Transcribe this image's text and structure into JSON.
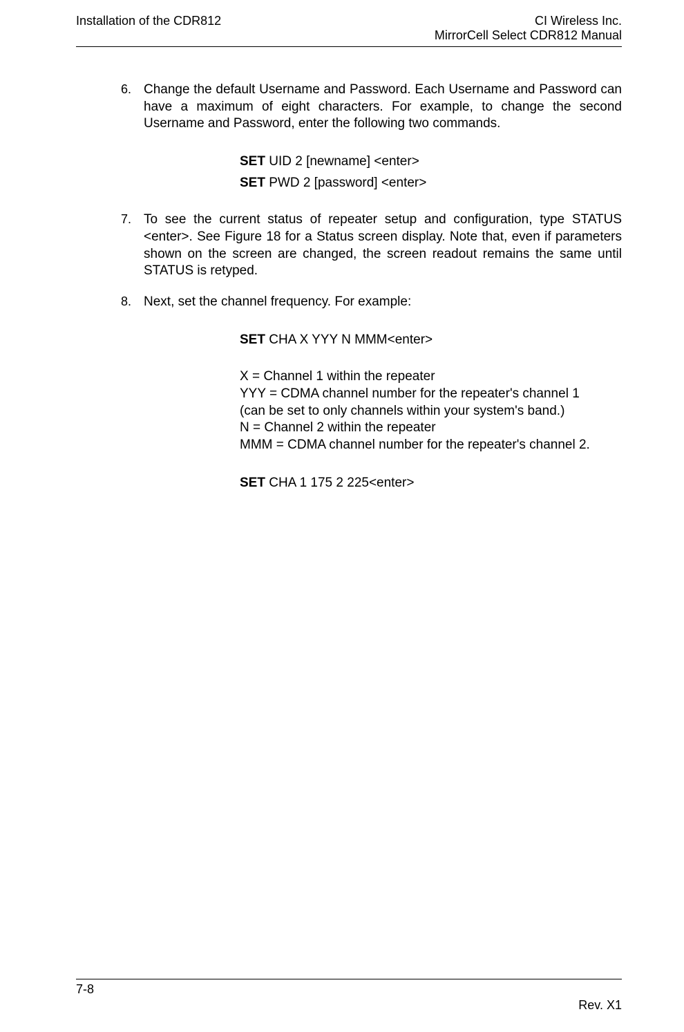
{
  "header": {
    "left": "Installation of the CDR812",
    "rightLine1": "CI Wireless Inc.",
    "rightLine2": "MirrorCell Select CDR812 Manual"
  },
  "items": [
    {
      "num": "6.",
      "text": "Change the default Username and Password. Each Username and Password can have a maximum of eight characters. For example, to change the second Username and Password, enter the following two commands."
    },
    {
      "num": "7.",
      "text": "To see the current status of repeater setup and configuration, type STATUS <enter>. See Figure 18 for a Status screen display. Note that, even if parameters shown on the screen are changed, the screen readout remains the same until STATUS is retyped."
    },
    {
      "num": "8.",
      "text": "Next, set the channel frequency. For example:"
    }
  ],
  "commands": {
    "block1": {
      "line1_bold": "SET",
      "line1_rest": " UID 2 [newname] <enter>",
      "line2_bold": "SET",
      "line2_rest": " PWD 2 [password] <enter>"
    },
    "block2": {
      "line1_bold": "SET",
      "line1_rest": " CHA X YYY N MMM<enter>"
    },
    "block3": {
      "line1_bold": "SET",
      "line1_rest": " CHA 1 175 2 225<enter>"
    }
  },
  "explain": {
    "l1": "X = Channel 1 within the repeater",
    "l2": "YYY = CDMA channel number for the repeater's channel 1",
    "l3": "(can be set to only channels within your system's band.)",
    "l4": "N = Channel 2 within the repeater",
    "l5": "MMM = CDMA channel number for the repeater's channel 2."
  },
  "footer": {
    "page": "7-8",
    "rev": "Rev. X1"
  }
}
